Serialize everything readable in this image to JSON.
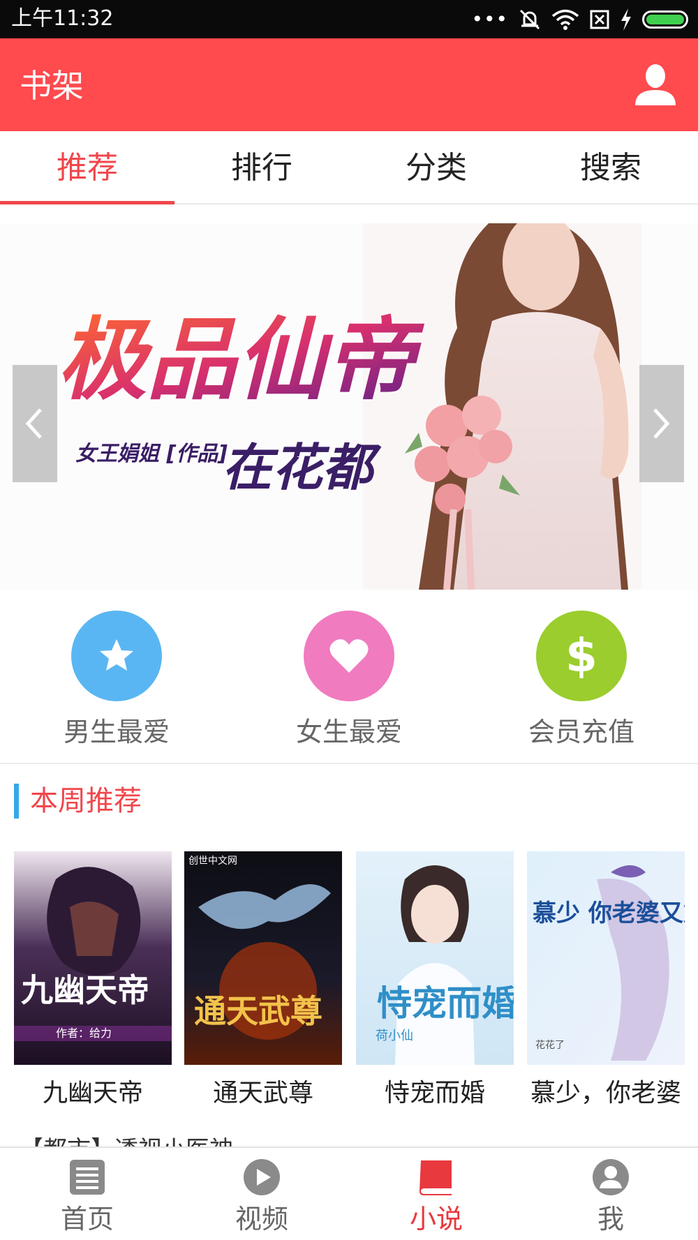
{
  "status_bar": {
    "time": "上午11:32",
    "icons": [
      "dots-icon",
      "silent-icon",
      "wifi-icon",
      "sim-off-icon",
      "charging-icon",
      "battery-icon"
    ],
    "battery_color": "#3fd04f"
  },
  "app_bar": {
    "title": "书架",
    "background": "#ff4a4e",
    "profile_icon": "person-icon"
  },
  "tabs": [
    {
      "label": "推荐",
      "active": true
    },
    {
      "label": "排行",
      "active": false
    },
    {
      "label": "分类",
      "active": false
    },
    {
      "label": "搜索",
      "active": false
    }
  ],
  "banner": {
    "title": "极品仙帝",
    "subtitle": "在花都",
    "author_credit": "女王娟姐 [作品]"
  },
  "quick_actions": [
    {
      "label": "男生最爱",
      "icon": "star-icon",
      "color": "#5ab6f2"
    },
    {
      "label": "女生最爱",
      "icon": "heart-icon",
      "color": "#f07bbf"
    },
    {
      "label": "会员充值",
      "icon": "dollar-icon",
      "color": "#9acd2d"
    }
  ],
  "weekly_section": {
    "title": "本周推荐",
    "books": [
      {
        "title": "九幽天帝",
        "cover_text": "九幽天帝",
        "cover_author": "作者：给力"
      },
      {
        "title": "通天武尊",
        "cover_text": "通天武尊",
        "cover_publisher": "创世中文网"
      },
      {
        "title": "恃宠而婚",
        "cover_text": "恃宠而婚",
        "cover_author": "荷小仙"
      },
      {
        "title": "慕少，你老婆",
        "cover_text": "慕少 你老婆又重生了",
        "cover_author": "花花了"
      }
    ]
  },
  "next_section_peek": "【都市】透视小医神",
  "bottom_nav": [
    {
      "label": "首页",
      "icon": "list-icon",
      "active": false
    },
    {
      "label": "视频",
      "icon": "play-icon",
      "active": false
    },
    {
      "label": "小说",
      "icon": "book-icon",
      "active": true
    },
    {
      "label": "我",
      "icon": "user-icon",
      "active": false
    }
  ]
}
